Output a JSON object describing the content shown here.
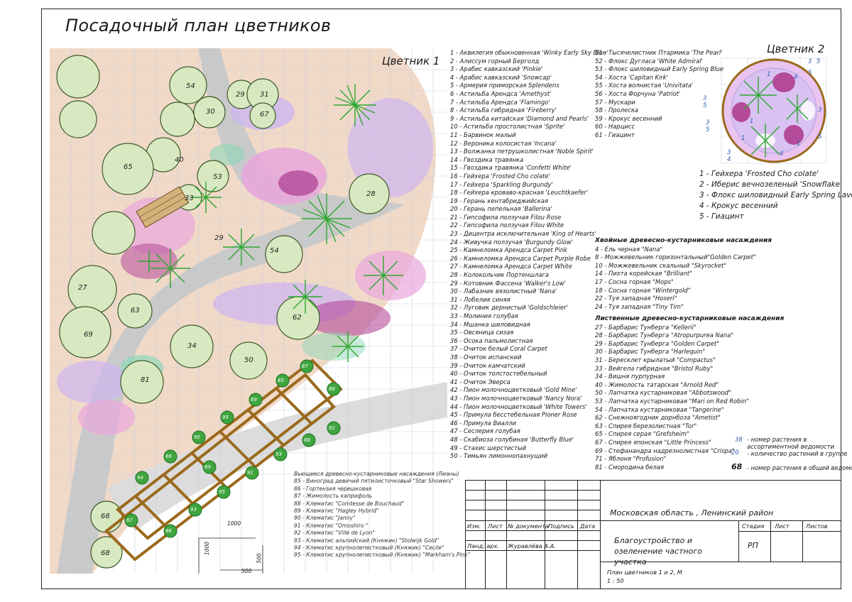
{
  "title": "Посадочный план цветников",
  "bed1_label": "Цветник 1",
  "bed2_label": "Цветник 2",
  "herbs_legend": [
    "1 - Аквилегия обыкновенная 'Winky Early Sky Blue'",
    "2 - Алиссум горный Берголд",
    "3 - Арабис кавказский 'Pinkie'",
    "4 - Арабис кавказский 'Snowcap'",
    "5 - Армерия приморская Splendens",
    "6 - Астильба Арендса 'Amethyst'",
    "7 - Астильба Арендса 'Flamingo'",
    "8 - Астильба гибридная 'Fireberry'",
    "9 - Астильба китайская 'Diamond and Pearls'",
    "10 - Астильба простолистная 'Sprite'",
    "11 - Барвинок малый",
    "12 - Вероника колосистая 'Incana'",
    "13 - Волжанка петрушколистная 'Noble Spirit'",
    "14 - Гвоздика травянка",
    "15 - Гвоздика травянка 'Confetti White'",
    "16 - Гейхера 'Frosted Cho colate'",
    "17 - Гейхера 'Sparkling Burgundy'",
    "18 - Гейхера кроваво-красная 'Leuchtkaefer'",
    "19 - Герань кентабриджийская",
    "20 - Герань пепельная 'Ballerina'",
    "21 - Гипсофила ползучая Filou Rose",
    "22 - Гипсофила ползучая Filou White",
    "23 - Дицентра исключительная 'King of Hearts'",
    "24 - Живучка ползучая 'Burgundy Glow'",
    "25 - Камнеломка Арендса Carpet Pink",
    "26 - Камнеломка Арендса Carpet Purple Robe",
    "27 - Камнеломка Арендса Carpet White",
    "28 - Колокольчик Портеншлага",
    "29 - Котовник Фассена 'Walker's Low'",
    "30 - Лабазник вязолистный 'Nana'",
    "31 - Лобелия синяя",
    "32 - Луговик дернистый 'Goldschleier'",
    "33 - Молиния голубая",
    "34 - Мшанка шиловидная",
    "35 - Овсяница сизая",
    "36 - Осока пальмолистная",
    "37 - Очиток белый Coral Carpet",
    "38 - Очиток испанский",
    "39 - Очиток камчатский",
    "40 - Очиток толстостебельный",
    "41 - Очиток Эверса",
    "42 - Пион молочноцветковый 'Gold Mine'",
    "43 - Пион молочноцветковый 'Nancy Nora'",
    "44 - Пион молочноцветковый 'White Towers'",
    "45 - Примула бесстебельная Pioner Rose",
    "46 - Примула Виалли",
    "47 - Сеслерия голубая",
    "48 - Скабиоза голубиная 'Butterfly Blue'",
    "49 - Стахис шерстистый",
    "50 - Тимьян лимоннопахнущий"
  ],
  "herbs_legend_2": [
    "51 - Тысячелистник Птармика 'The Pearl'",
    "52 - Флокс Дугласа 'White Admiral'",
    "53 - Флокс шиловидный Early Spring Blue",
    "54 - Хоста 'Capitan Kirk'",
    "55 - Хоста волнистая 'Univitata'",
    "56 - Хоста Форчуна 'Patriot'",
    "57 - Мускари",
    "58 - Пролеска",
    "59 - Крокус весенний",
    "60 - Нарцисс",
    "61 - Гиацинт"
  ],
  "bed2_legend": [
    "1 - Гейхера 'Frosted Cho colate'",
    "2 - Иберис вечнозеленый 'Snowflake'",
    "3 - Флокс шиловидный Early Spring Lavender",
    "4 - Крокус весенний",
    "5 - Гиацинт"
  ],
  "conifers_heading": "Хвойные древесно-кустарниковые насаждения",
  "conifers": [
    "4 - Ель черная \"Nana\"",
    "8 - Можжевельник горизонтальный\"Golden Carpet\"",
    "10 - Можжевельник скальный \"Skyrocket\"",
    "14 - Пихта корейская \"Brilliant\"",
    "17 - Сосна горная \"Mops\"",
    "18 - Сосна горная \"Wintergold\"",
    "22 - Туя западная \"Hoseri\"",
    "24 - Туя западная \"Tiny Tim\""
  ],
  "deciduous_heading": "Лиственные древесно-кустарниковые насаждения",
  "deciduous": [
    "27 - Барбарис Тунберга \"Kellerii\"",
    "28 - Барбарис Тунберга \"Atropurpurea Nana\"",
    "29 - Барбарис Тунберга \"Golden Carpet\"",
    "30 - Барбарис Тунберга \"Harlequin\"",
    "31 - Бересклет крылатый \"Compactus\"",
    "33 - Вейгела гибридная \"Bristol Ruby\"",
    "34 - Вишня пурпурная",
    "40 - Жимолость татарская \"Arnold Red\"",
    "50 - Лапчатка кустарниковая \"Abbotswood\"",
    "53 - Лапчатка кустарниковая \"Mari on Red Robin\"",
    "54 - Лапчатка кустарниковая \"Tangerine\"",
    "62 - Снежноягодник дорнбоза \"Ametist\"",
    "63 - Спирея березолистная \"Tor\"",
    "65 - Спирея серая \"Grefsheim\"",
    "67 - Спирея японская \"Little Princess\"",
    "69 - Стефанандра надрезнолистная \"Crispa\"",
    "71 - Яблоня \"Profusion\"",
    "81 - Смородина белая"
  ],
  "vines_heading": "Вьющиеся древесно-кустарниковые насаждения (Лианы)",
  "vines": [
    "85 - Виноград девичий пятилисточковый \"Star Showers\"",
    "86 - Гортензия черешковая",
    "87 - Жимолость каприфоль",
    "88 - Клематис \"Comtesse de Bouchaud\"",
    "89 - Клематис \"Hagley Hybrid\"",
    "90 - Клематис \"Janny\"",
    "91 - Клематис \"Omoshiro \"",
    "92 - Клематис \"Ville de Lyon\"",
    "93 - Клематис альпийский (Княжик) \"Stolwijk Gold\"",
    "94 - Клематис крупнолепестковый (Княжик) \"Cecile\"",
    "95 - Клематис крупнолепестковый (Княжик) \"Markham's Pink\""
  ],
  "key_notes": {
    "n1_num": "38",
    "n1_text": "- номер растения в ассортиментной ведомости",
    "n2_num": "20",
    "n2_text": "- количество растений в группе",
    "n3_num": "68",
    "n3_text": "- номер растения в общей ведомости"
  },
  "plan_numbers": [
    "54",
    "29",
    "31",
    "30",
    "67",
    "65",
    "40",
    "53",
    "28",
    "33",
    "29",
    "54",
    "27",
    "63",
    "62",
    "69",
    "34",
    "50",
    "81",
    "68",
    "68"
  ],
  "bed2_marks": [
    "3",
    "5",
    "3",
    "5",
    "1",
    "4",
    "1",
    "5",
    "3",
    "5",
    "5",
    "1",
    "3",
    "4",
    "1",
    "3",
    "4"
  ],
  "vine_numbers": [
    "87",
    "85",
    "89",
    "95",
    "90",
    "86",
    "94",
    "92",
    "88",
    "93",
    "91",
    "95",
    "93",
    "86",
    "87",
    "88",
    "89"
  ],
  "dims": [
    "1000",
    "1000",
    "500",
    "500"
  ],
  "stamp": {
    "location": "Московская область , Ленинский район",
    "project": "Благоустройство и озеленение частного участка",
    "sheet_title": "План цветников 1 и 2, М 1 : 50",
    "col_izm": "Изм.",
    "col_list": "Лист",
    "col_doc": "№ документа",
    "col_sign": "Подпись",
    "col_date": "Дата",
    "role": "Ланд. арх.",
    "author": "Журавлёва А.А.",
    "stage_label": "Стадия",
    "sheet_label": "Лист",
    "sheets_label": "Листов",
    "stage_value": "РП"
  },
  "colors": {
    "path": "#c9c9c9",
    "lawn": "#f1d9c8",
    "tree": "#d8e8c0",
    "conifer": "#2ea830",
    "bed_pink": "#e9a6dc",
    "bed_purple": "#b44a9a",
    "bed_lilac": "#cdb6ef",
    "pergola": "#9a6a1c",
    "vine_node": "#3fa53f",
    "grid": "#c8d2dc"
  }
}
